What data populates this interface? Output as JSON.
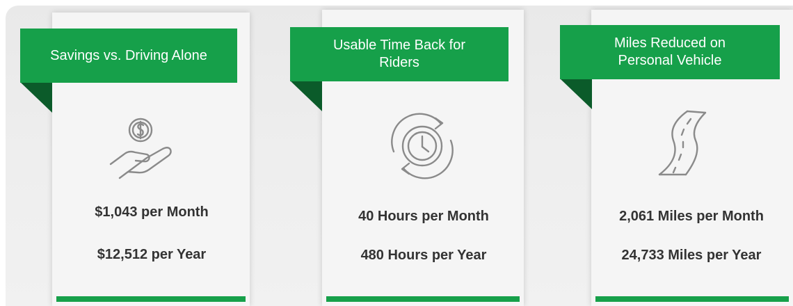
{
  "cards": [
    {
      "title": "Savings vs. Driving Alone",
      "icon": "dollar-hand-icon",
      "stat_month": "$1,043 per Month",
      "stat_year": "$12,512 per Year"
    },
    {
      "title": "Usable Time Back for Riders",
      "icon": "clock-refresh-icon",
      "stat_month": "40 Hours per Month",
      "stat_year": "480 Hours per Year"
    },
    {
      "title": "Miles Reduced on Personal Vehicle",
      "icon": "winding-road-icon",
      "stat_month": "2,061 Miles per Month",
      "stat_year": "24,733 Miles per Year"
    }
  ],
  "colors": {
    "accent_green": "#16a04a",
    "fold_green": "#0b5b2a",
    "text": "#333333",
    "icon_gray": "#8a8a8a"
  }
}
